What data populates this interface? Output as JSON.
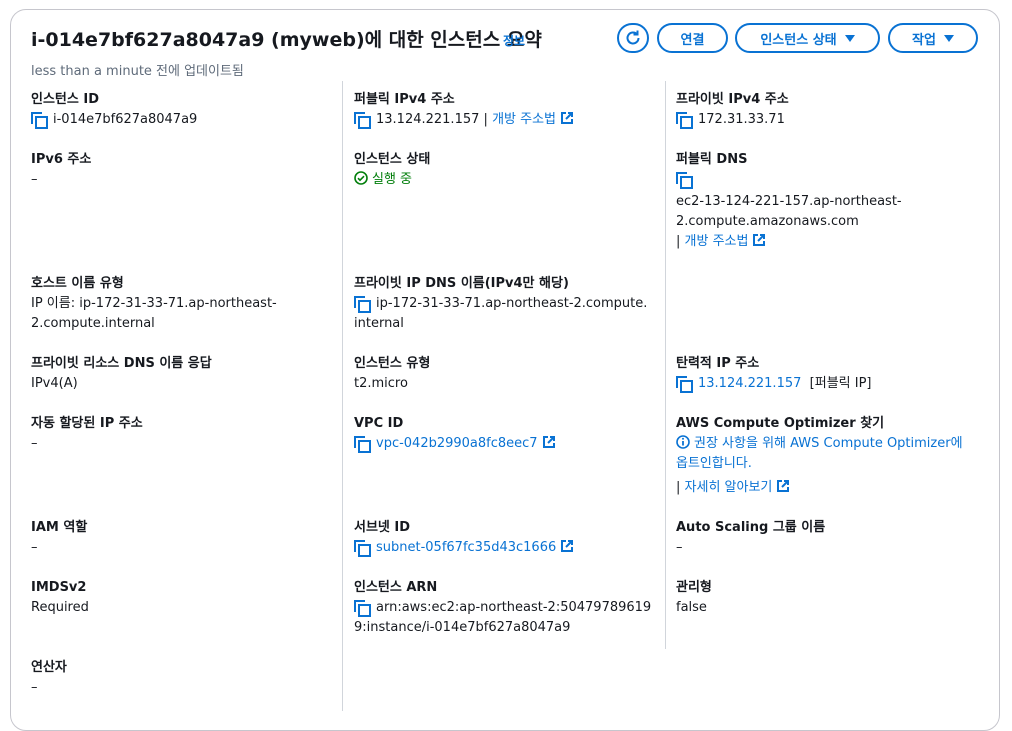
{
  "header": {
    "title": "i-014e7bf627a8047a9 (myweb)에 대한 인스턴스 요약",
    "info": "정보",
    "subtitle": "less than a minute 전에 업데이트됨",
    "buttons": {
      "connect": "연결",
      "instance_state": "인스턴스 상태",
      "actions": "작업"
    }
  },
  "col1": {
    "instance_id": {
      "label": "인스턴스 ID",
      "value": "i-014e7bf627a8047a9"
    },
    "ipv6": {
      "label": "IPv6 주소",
      "value": "–"
    },
    "hostname_type": {
      "label": "호스트 이름 유형",
      "value_line1": "IP 이름: ip-172-31-33-71.ap-northeast-",
      "value_line2": "2.compute.internal"
    },
    "private_dns_answer": {
      "label": "프라이빗 리소스 DNS 이름 응답",
      "value": "IPv4(A)"
    },
    "auto_ip": {
      "label": "자동 할당된 IP 주소",
      "value": "–"
    },
    "iam_role": {
      "label": "IAM 역할",
      "value": "–"
    },
    "imdsv2": {
      "label": "IMDSv2",
      "value": "Required"
    },
    "operator": {
      "label": "연산자",
      "value": "–"
    }
  },
  "col2": {
    "public_ipv4": {
      "label": "퍼블릭 IPv4 주소",
      "value": "13.124.221.157",
      "sep": "|",
      "link": "개방 주소법"
    },
    "instance_state": {
      "label": "인스턴스 상태",
      "value": "실행 중"
    },
    "private_ip_dns": {
      "label": "프라이빗 IP DNS 이름(IPv4만 해당)",
      "value_line1": "ip-172-31-33-71.ap-northeast-2.compute.",
      "value_line2": "internal"
    },
    "instance_type": {
      "label": "인스턴스 유형",
      "value": "t2.micro"
    },
    "vpc_id": {
      "label": "VPC ID",
      "value": "vpc-042b2990a8fc8eec7"
    },
    "subnet_id": {
      "label": "서브넷 ID",
      "value": "subnet-05f67fc35d43c1666"
    },
    "instance_arn": {
      "label": "인스턴스 ARN",
      "value_line1": "arn:aws:ec2:ap-northeast-2:50479789619",
      "value_line2": "9:instance/i-014e7bf627a8047a9"
    }
  },
  "col3": {
    "private_ipv4": {
      "label": "프라이빗 IPv4 주소",
      "value": "172.31.33.71"
    },
    "public_dns": {
      "label": "퍼블릭 DNS",
      "value_line1": "ec2-13-124-221-157.ap-northeast-",
      "value_line2": "2.compute.amazonaws.com",
      "sep": "|",
      "link": "개방 주소법"
    },
    "elastic_ip": {
      "label": "탄력적 IP 주소",
      "value": "13.124.221.157",
      "tag": "[퍼블릭 IP]"
    },
    "optimizer": {
      "label": "AWS Compute Optimizer 찾기",
      "value_line1": "권장 사항을 위해 AWS Compute Optimizer에",
      "value_line2": "옵트인합니다.",
      "sep": "|",
      "link": "자세히 알아보기"
    },
    "asg_name": {
      "label": "Auto Scaling 그룹 이름",
      "value": "–"
    },
    "managed": {
      "label": "관리형",
      "value": "false"
    }
  },
  "colors": {
    "accent": "#0972d3",
    "success": "#037f0c",
    "text": "#16191f",
    "muted": "#5f6b7a"
  }
}
